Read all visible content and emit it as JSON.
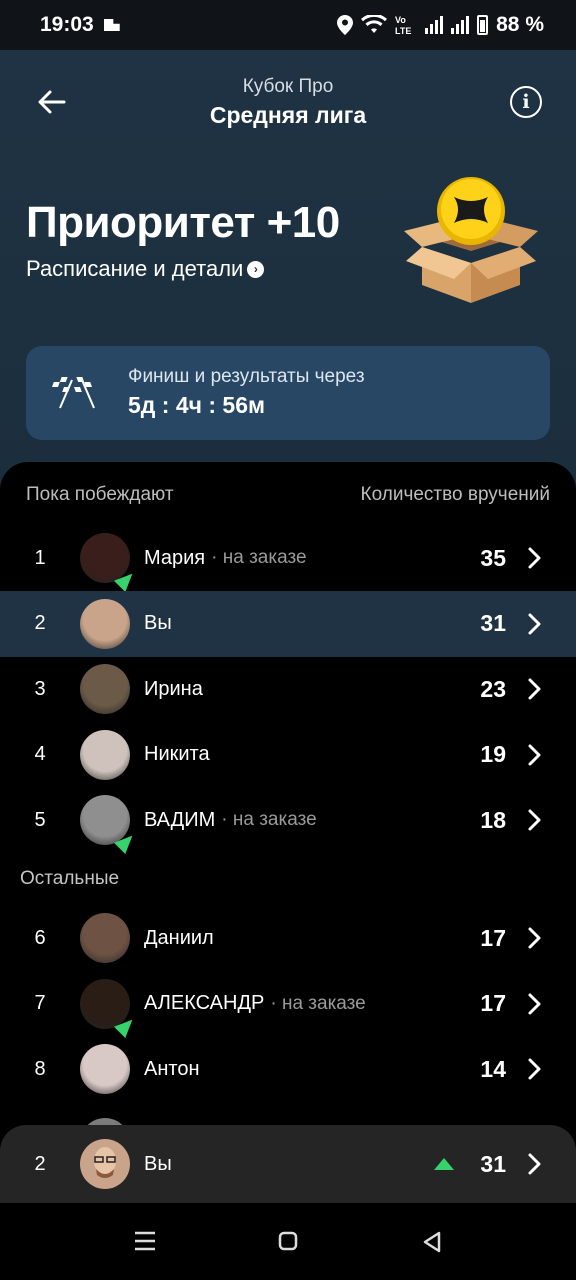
{
  "status_bar": {
    "time": "19:03",
    "network": "Vo LTE",
    "battery": "88 %"
  },
  "header": {
    "subtitle": "Кубок Про",
    "title": "Средняя лига"
  },
  "hero": {
    "priority": "Приоритет +10",
    "schedule_link": "Расписание и детали"
  },
  "finish": {
    "label": "Финиш и результаты через",
    "countdown": "5д : 4ч : 56м"
  },
  "leaderboard": {
    "col_left": "Пока побеждают",
    "col_right": "Количество вручений",
    "others_label": "Остальные",
    "leaders": [
      {
        "rank": "1",
        "name": "Мария",
        "status": "· на заказе",
        "count": "35",
        "on_order": true,
        "avatar_color": "#3a1e1c"
      },
      {
        "rank": "2",
        "name": "Вы",
        "status": "",
        "count": "31",
        "on_order": false,
        "avatar_color": "#c9a48a",
        "is_me": true
      },
      {
        "rank": "3",
        "name": "Ирина",
        "status": "",
        "count": "23",
        "on_order": false,
        "avatar_color": "#6b5a47"
      },
      {
        "rank": "4",
        "name": "Никита",
        "status": "",
        "count": "19",
        "on_order": false,
        "avatar_color": "#cfc2bc"
      },
      {
        "rank": "5",
        "name": "ВАДИМ",
        "status": "· на заказе",
        "count": "18",
        "on_order": true,
        "avatar_color": "#8f8f8f"
      }
    ],
    "others": [
      {
        "rank": "6",
        "name": "Даниил",
        "status": "",
        "count": "17",
        "on_order": false,
        "avatar_color": "#6e5244"
      },
      {
        "rank": "7",
        "name": "АЛЕКСАНДР",
        "status": "· на заказе",
        "count": "17",
        "on_order": true,
        "avatar_color": "#2a1d16"
      },
      {
        "rank": "8",
        "name": "Антон",
        "status": "",
        "count": "14",
        "on_order": false,
        "avatar_color": "#d9c9c6"
      }
    ]
  },
  "my_position": {
    "rank": "2",
    "name": "Вы",
    "count": "31",
    "trend": "up"
  },
  "colors": {
    "accent_green": "#36d26b",
    "hero_bg": "#1f3344",
    "finish_bg": "#274765"
  }
}
